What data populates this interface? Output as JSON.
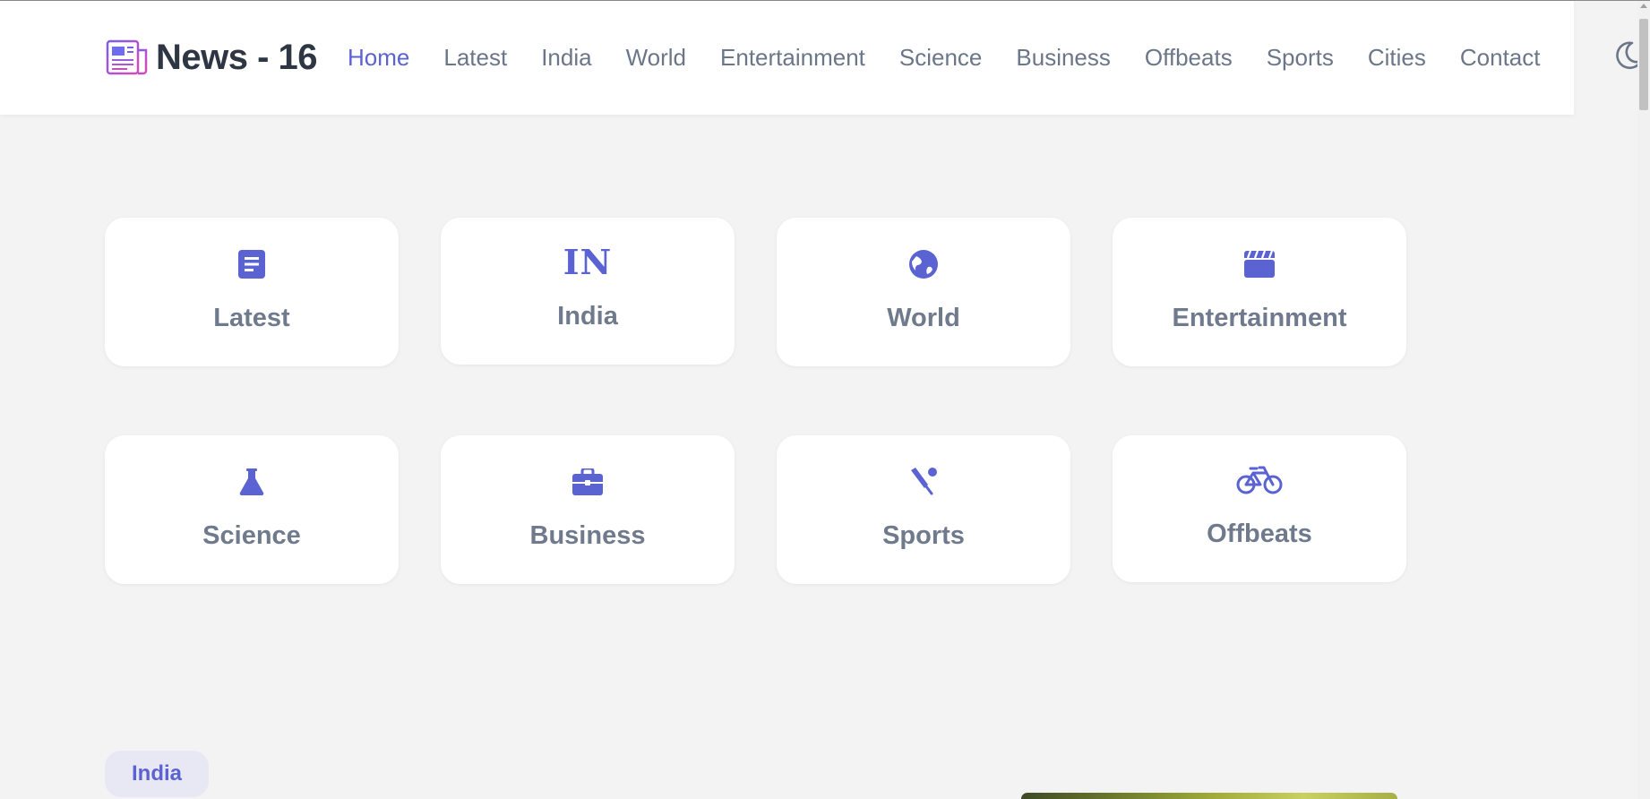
{
  "brand": {
    "name": "News - 16"
  },
  "nav": {
    "items": [
      {
        "label": "Home",
        "active": true
      },
      {
        "label": "Latest"
      },
      {
        "label": "India"
      },
      {
        "label": "World"
      },
      {
        "label": "Entertainment"
      },
      {
        "label": "Science"
      },
      {
        "label": "Business"
      },
      {
        "label": "Offbeats"
      },
      {
        "label": "Sports"
      },
      {
        "label": "Cities"
      },
      {
        "label": "Contact"
      }
    ],
    "theme_toggle_icon": "moon-icon"
  },
  "categories": [
    {
      "label": "Latest",
      "icon": "document-icon"
    },
    {
      "label": "India",
      "icon": "india-icon",
      "icon_text": "IN"
    },
    {
      "label": "World",
      "icon": "globe-icon"
    },
    {
      "label": "Entertainment",
      "icon": "clapperboard-icon"
    },
    {
      "label": "Science",
      "icon": "flask-icon"
    },
    {
      "label": "Business",
      "icon": "briefcase-icon"
    },
    {
      "label": "Sports",
      "icon": "cricket-icon"
    },
    {
      "label": "Offbeats",
      "icon": "bicycle-icon"
    }
  ],
  "section": {
    "tag": "India"
  },
  "colors": {
    "accent": "#5b63d3",
    "text_muted": "#6f7a8d",
    "background": "#f3f3f3"
  }
}
